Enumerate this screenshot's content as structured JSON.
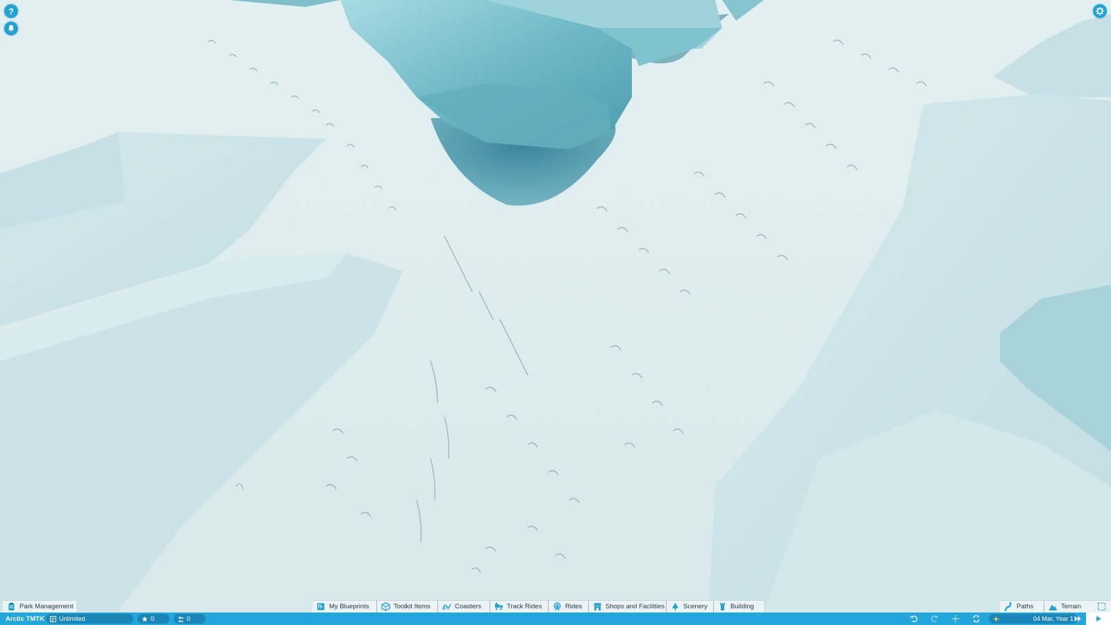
{
  "top_left": {
    "help_icon": "question-mark-icon",
    "help_glyph": "?",
    "notifications_icon": "bell-icon"
  },
  "top_right": {
    "settings_icon": "gear-icon"
  },
  "toolbar": {
    "park_management": {
      "label": "Park Management",
      "icon": "clipboard-icon"
    },
    "blueprints": {
      "label": "My Blueprints",
      "icon": "blueprint-icon"
    },
    "toolkit": {
      "label": "Toolkit Items",
      "icon": "cube-icon"
    },
    "coasters": {
      "label": "Coasters",
      "icon": "coaster-icon"
    },
    "track_rides": {
      "label": "Track Rides",
      "icon": "train-icon"
    },
    "rides": {
      "label": "Rides",
      "icon": "ferris-wheel-icon"
    },
    "shops": {
      "label": "Shops and Facilities",
      "icon": "shop-icon"
    },
    "scenery": {
      "label": "Scenery",
      "icon": "tree-icon"
    },
    "building": {
      "label": "Building",
      "icon": "tower-icon"
    },
    "paths": {
      "label": "Paths",
      "icon": "path-icon"
    },
    "terrain": {
      "label": "Terrain",
      "icon": "mountain-icon"
    },
    "select_icon": "selection-box-icon"
  },
  "status_bar": {
    "park_name": "Arctic TMTK",
    "money": "Unlimited",
    "rating": "0",
    "guests": "0",
    "date": "04 Mar, Year 1",
    "weather_icon": "sun-icon",
    "undo_icon": "undo-icon",
    "redo_icon": "redo-icon",
    "camera_icon": "camera-move-icon",
    "sync_icon": "sync-icon",
    "speed_icon": "fast-forward-icon",
    "play_icon": "play-icon"
  },
  "colors": {
    "accent": "#23a6dc",
    "accent_dark": "#1a86b8",
    "snow": "#e3f1f2",
    "ice": "#7fc3cf",
    "tab_bg": "#ecf3f5",
    "tab_text": "#243b48"
  }
}
